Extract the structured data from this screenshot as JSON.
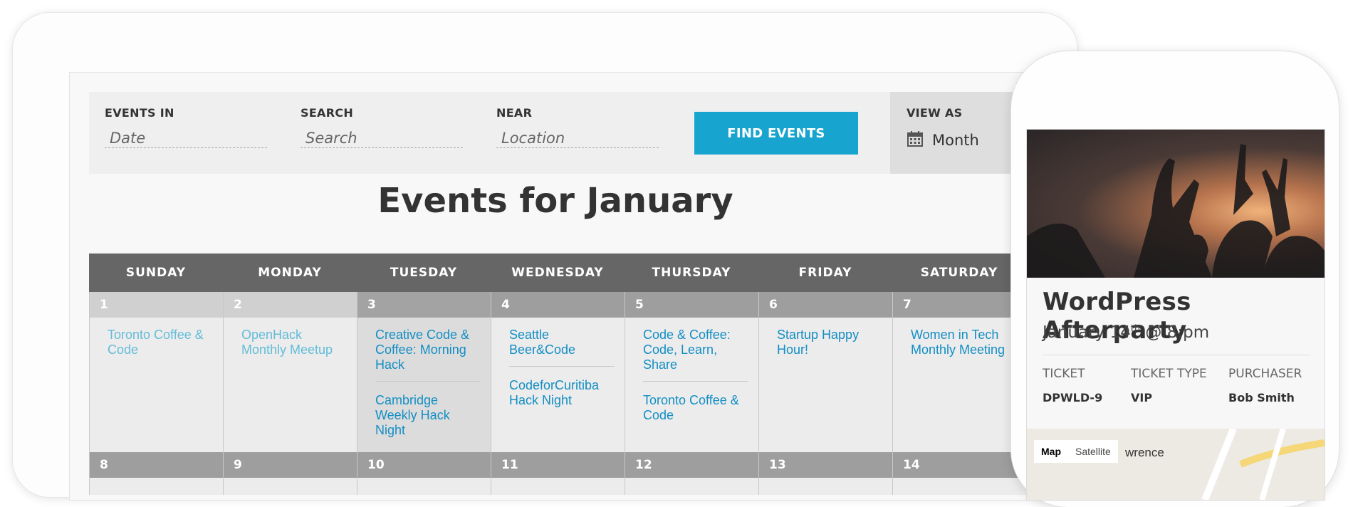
{
  "filters": {
    "events_in_label": "EVENTS IN",
    "date_placeholder": "Date",
    "search_label": "SEARCH",
    "search_placeholder": "Search",
    "near_label": "NEAR",
    "location_placeholder": "Location",
    "find_button": "FIND EVENTS",
    "view_as_label": "VIEW AS",
    "view_as_value": "Month"
  },
  "title": "Events for January",
  "weekdays": [
    "SUNDAY",
    "MONDAY",
    "TUESDAY",
    "WEDNESDAY",
    "THURSDAY",
    "FRIDAY",
    "SATURDAY"
  ],
  "week1": [
    {
      "num": "1",
      "events": [
        "Toronto Coffee & Code"
      ]
    },
    {
      "num": "2",
      "events": [
        "OpenHack Monthly Meetup"
      ]
    },
    {
      "num": "3",
      "events": [
        "Creative Code & Coffee: Morning Hack",
        "Cambridge Weekly Hack Night"
      ]
    },
    {
      "num": "4",
      "events": [
        "Seattle Beer&Code",
        "CodeforCuritiba Hack Night"
      ]
    },
    {
      "num": "5",
      "events": [
        "Code & Coffee: Code, Learn, Share",
        "Toronto Coffee & Code"
      ]
    },
    {
      "num": "6",
      "events": [
        "Startup Happy Hour!"
      ]
    },
    {
      "num": "7",
      "events": [
        "Women in Tech Monthly Meeting"
      ]
    }
  ],
  "week2": [
    "8",
    "9",
    "10",
    "11",
    "12",
    "13",
    "14"
  ],
  "phone": {
    "event_name": "WordPress Afterparty",
    "date_text": "January 14",
    "date_suffix": "th",
    "time_text": " @ 8:pm",
    "ticket_label": "TICKET",
    "ticket_value": "DPWLD-9",
    "type_label": "TICKET TYPE",
    "type_value": "VIP",
    "purchaser_label": "PURCHASER",
    "purchaser_value": "Bob Smith",
    "map_tab": "Map",
    "satellite_tab": "Satellite",
    "map_place": "wrence"
  },
  "colors": {
    "accent": "#17a4ce",
    "header": "#666666"
  }
}
